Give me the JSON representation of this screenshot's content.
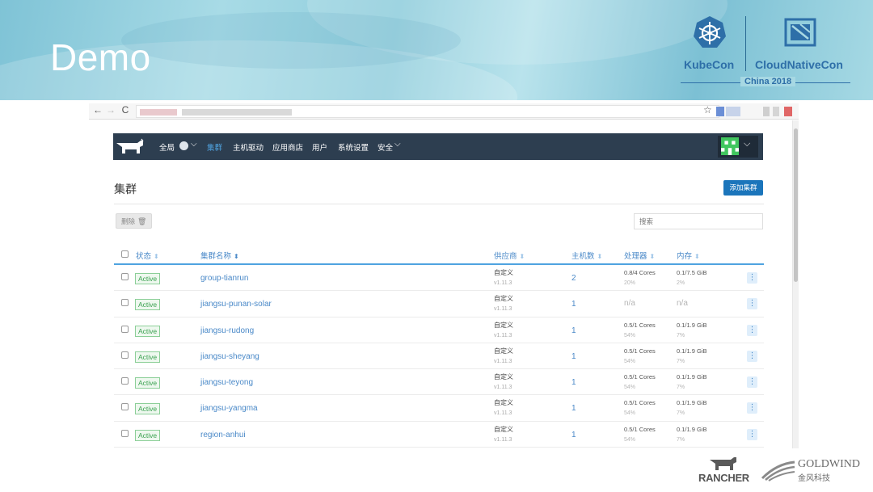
{
  "slide": {
    "title": "Demo",
    "conference": {
      "kubecon": "KubeCon",
      "cloudnativecon": "CloudNativeCon",
      "edition": "China 2018"
    },
    "footer": {
      "rancher": "RANCHER",
      "goldwind": "GOLDWIND",
      "goldwind_cn": "金风科技"
    }
  },
  "browser": {
    "back": "←",
    "forward": "→",
    "reload": "C",
    "star": "☆"
  },
  "nav": {
    "scope": "全局",
    "items": [
      {
        "label": "集群",
        "active": true
      },
      {
        "label": "主机驱动"
      },
      {
        "label": "应用商店"
      },
      {
        "label": "用户"
      },
      {
        "label": "系统设置"
      },
      {
        "label": "安全"
      }
    ]
  },
  "page": {
    "title": "集群",
    "add_button": "添加集群",
    "delete_button": "删除",
    "search_placeholder": "搜索"
  },
  "table": {
    "headers": {
      "state": "状态",
      "name": "集群名称",
      "provider": "供应商",
      "hosts": "主机数",
      "cpu": "处理器",
      "memory": "内存"
    },
    "rows": [
      {
        "state": "Active",
        "name": "group-tianrun",
        "provider": "自定义",
        "version": "v1.11.3",
        "hosts": "2",
        "cpu": "0.8/4 Cores",
        "cpu_pct": "20%",
        "mem": "0.1/7.5 GiB",
        "mem_pct": "2%"
      },
      {
        "state": "Active",
        "name": "jiangsu-punan-solar",
        "provider": "自定义",
        "version": "v1.11.3",
        "hosts": "1",
        "cpu": "n/a",
        "cpu_pct": "",
        "mem": "n/a",
        "mem_pct": ""
      },
      {
        "state": "Active",
        "name": "jiangsu-rudong",
        "provider": "自定义",
        "version": "v1.11.3",
        "hosts": "1",
        "cpu": "0.5/1 Cores",
        "cpu_pct": "54%",
        "mem": "0.1/1.9 GiB",
        "mem_pct": "7%"
      },
      {
        "state": "Active",
        "name": "jiangsu-sheyang",
        "provider": "自定义",
        "version": "v1.11.3",
        "hosts": "1",
        "cpu": "0.5/1 Cores",
        "cpu_pct": "54%",
        "mem": "0.1/1.9 GiB",
        "mem_pct": "7%"
      },
      {
        "state": "Active",
        "name": "jiangsu-teyong",
        "provider": "自定义",
        "version": "v1.11.3",
        "hosts": "1",
        "cpu": "0.5/1 Cores",
        "cpu_pct": "54%",
        "mem": "0.1/1.9 GiB",
        "mem_pct": "7%"
      },
      {
        "state": "Active",
        "name": "jiangsu-yangma",
        "provider": "自定义",
        "version": "v1.11.3",
        "hosts": "1",
        "cpu": "0.5/1 Cores",
        "cpu_pct": "54%",
        "mem": "0.1/1.9 GiB",
        "mem_pct": "7%"
      },
      {
        "state": "Active",
        "name": "region-anhui",
        "provider": "自定义",
        "version": "v1.11.3",
        "hosts": "1",
        "cpu": "0.5/1 Cores",
        "cpu_pct": "54%",
        "mem": "0.1/1.9 GiB",
        "mem_pct": "7%"
      }
    ]
  },
  "colors": {
    "navbar": "#2d3e50",
    "accent": "#1b75bb",
    "link": "#4a89c8",
    "active_badge": "#3aa150"
  },
  "icons": {
    "globe": "globe-icon",
    "trash": "trash-icon",
    "row_menu": "kebab-menu-icon",
    "sort": "sort-icon"
  }
}
